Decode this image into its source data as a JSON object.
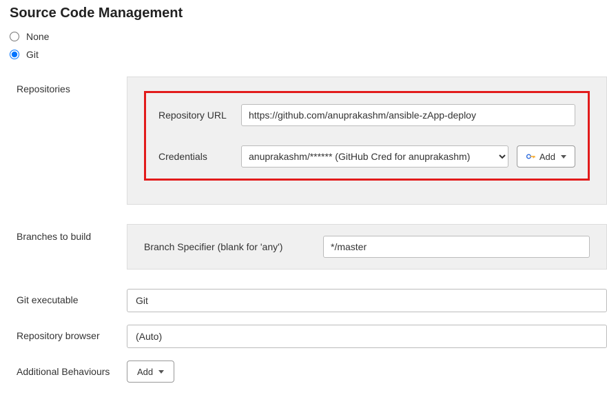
{
  "section_title": "Source Code Management",
  "scm_options": {
    "none": "None",
    "git": "Git",
    "selected": "git"
  },
  "repositories": {
    "label": "Repositories",
    "repo_url_label": "Repository URL",
    "repo_url_value": "https://github.com/anuprakashm/ansible-zApp-deploy",
    "credentials_label": "Credentials",
    "credentials_value": "anuprakashm/****** (GitHub Cred for anuprakashm)",
    "add_label": "Add"
  },
  "branches": {
    "label": "Branches to build",
    "specifier_label": "Branch Specifier (blank for 'any')",
    "specifier_value": "*/master"
  },
  "git_exec": {
    "label": "Git executable",
    "value": "Git"
  },
  "repo_browser": {
    "label": "Repository browser",
    "value": "(Auto)"
  },
  "additional": {
    "label": "Additional Behaviours",
    "add_label": "Add"
  }
}
